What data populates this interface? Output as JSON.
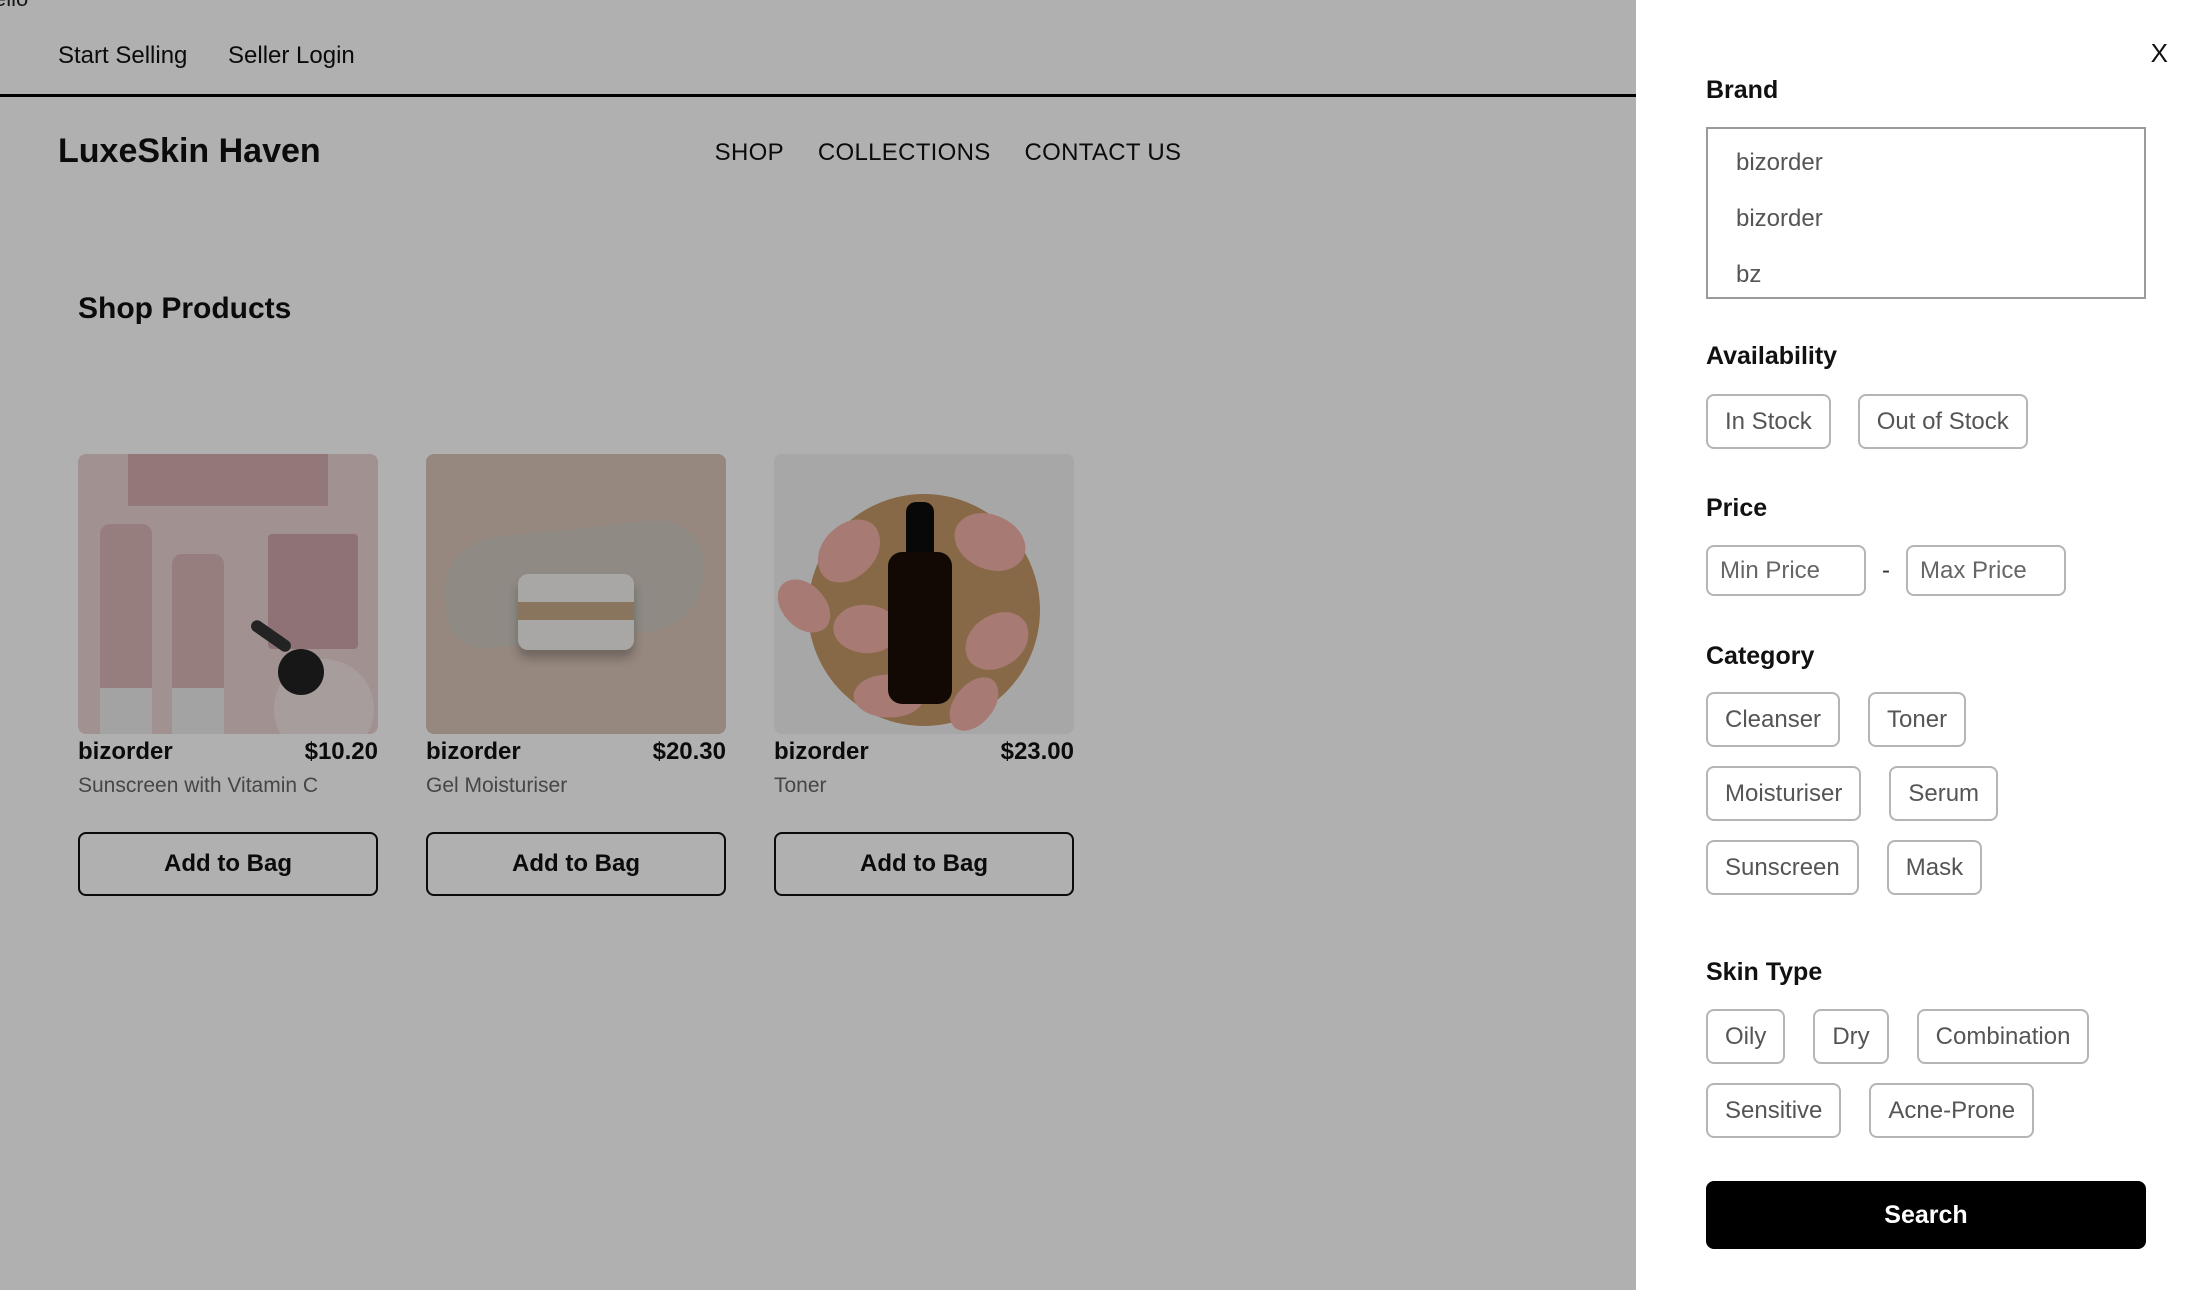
{
  "topbar": {
    "corner_text": "ello",
    "start_selling": "Start Selling",
    "seller_login": "Seller Login"
  },
  "header": {
    "brand": "LuxeSkin Haven",
    "nav": [
      "SHOP",
      "COLLECTIONS",
      "CONTACT US"
    ]
  },
  "main": {
    "title": "Shop Products",
    "products": [
      {
        "brand": "bizorder",
        "price": "$10.20",
        "name": "Sunscreen with Vitamin C",
        "button": "Add to Bag"
      },
      {
        "brand": "bizorder",
        "price": "$20.30",
        "name": "Gel Moisturiser",
        "button": "Add to Bag"
      },
      {
        "brand": "bizorder",
        "price": "$23.00",
        "name": "Toner",
        "button": "Add to Bag"
      }
    ]
  },
  "filters": {
    "close_label": "X",
    "brand": {
      "label": "Brand",
      "options": [
        "bizorder",
        "bizorder",
        "bz"
      ]
    },
    "availability": {
      "label": "Availability",
      "options": [
        "In Stock",
        "Out of Stock"
      ]
    },
    "price": {
      "label": "Price",
      "min_placeholder": "Min Price",
      "max_placeholder": "Max Price",
      "separator": "-"
    },
    "category": {
      "label": "Category",
      "options": [
        "Cleanser",
        "Toner",
        "Moisturiser",
        "Serum",
        "Sunscreen",
        "Mask"
      ]
    },
    "skin_type": {
      "label": "Skin Type",
      "options": [
        "Oily",
        "Dry",
        "Combination",
        "Sensitive",
        "Acne-Prone"
      ]
    },
    "search_label": "Search"
  },
  "colors": {
    "overlay": "#000000",
    "primary_button": "#000000",
    "chip_border": "#b5b5b5"
  }
}
